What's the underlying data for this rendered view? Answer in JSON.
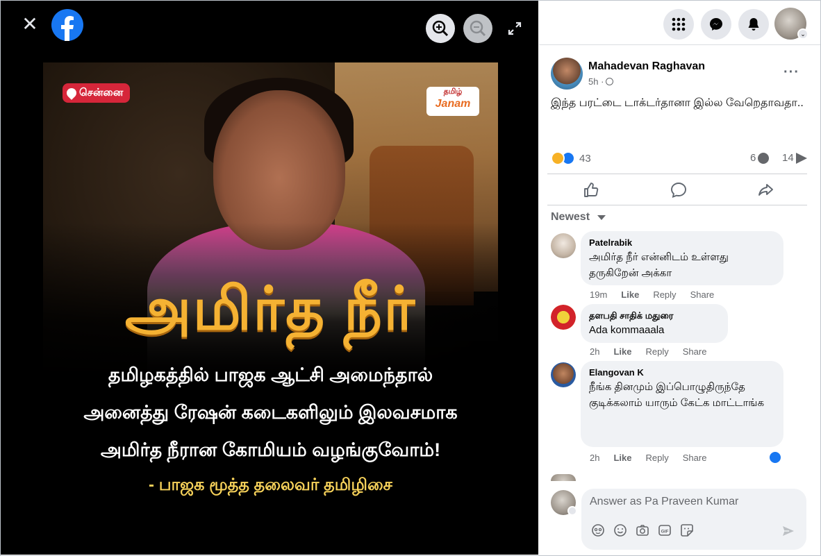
{
  "viewer": {
    "close_icon": "close-icon",
    "logo_icon": "facebook-logo",
    "zoom_in_icon": "zoom-in-icon",
    "zoom_out_icon": "zoom-out-icon",
    "expand_icon": "expand-icon"
  },
  "image": {
    "location": "சென்னை",
    "brand_top": "தமிழ்",
    "brand_bottom": "Janam",
    "headline": "அமிர்த நீர்",
    "line1": "தமிழகத்தில் பாஜக ஆட்சி அமைந்தால்",
    "line2": "அனைத்து ரேஷன் கடைகளிலும் இலவசமாக",
    "line3": "அமிர்த நீரான கோமியம் வழங்குவோம்!",
    "quote": "- பாஜக மூத்த தலைவர் தமிழிசை"
  },
  "topbar": {
    "icons": [
      "menu-grid-icon",
      "messenger-icon",
      "notifications-icon",
      "account-icon"
    ]
  },
  "post": {
    "author": "Mahadevan Raghavan",
    "time": "5h ·",
    "text": "இந்த பரட்டை டாக்டர்தானா இல்ல வேறெதாவதா..",
    "reaction_count": "43",
    "comment_count": "6",
    "share_count": "14",
    "sort_label": "Newest"
  },
  "comments": [
    {
      "name": "Patelrabik",
      "text": "அமிர்த நீர் என்னிடம் உள்ளது தருகிறேன் அக்கா",
      "time": "19m",
      "like": "Like",
      "reply": "Reply",
      "share": "Share"
    },
    {
      "name": "தளபதி சாதிக் மதுரை",
      "text": "Ada kommaaala",
      "time": "2h",
      "like": "Like",
      "reply": "Reply",
      "share": "Share"
    },
    {
      "name": "Elangovan K",
      "text": "நீங்க தினமும் இப்பொழுதிருந்தே குடிக்கலாம் யாரும் கேட்க மாட்டாங்க",
      "time": "2h",
      "like": "Like",
      "reply": "Reply",
      "share": "Share"
    }
  ],
  "composer": {
    "placeholder": "Answer as Pa Praveen Kumar"
  }
}
